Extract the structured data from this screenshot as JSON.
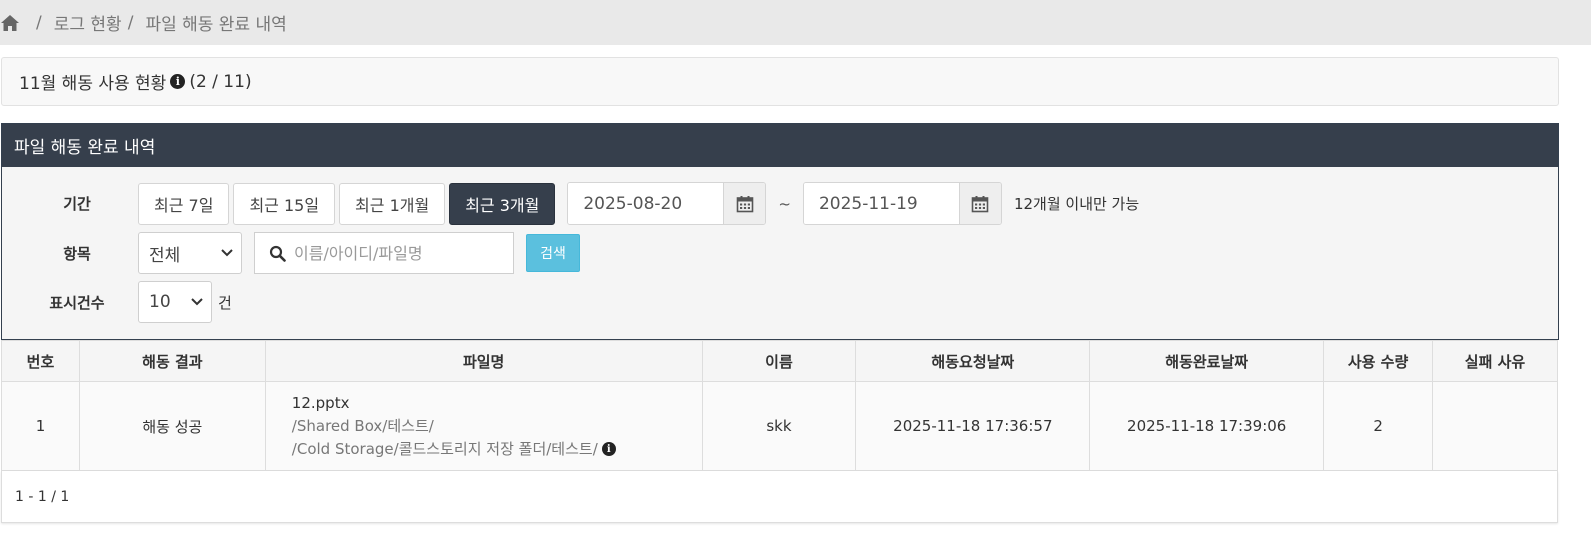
{
  "breadcrumb": {
    "home_icon": "home-icon",
    "separator": "/",
    "items": [
      "로그 현황",
      "파일 해동 완료 내역"
    ]
  },
  "usage": {
    "label": "11월 해동 사용 현황",
    "info_icon": "info-circle-icon",
    "count": "(2 / 11)"
  },
  "panel": {
    "title": "파일 해동 완료 내역",
    "period_label": "기간",
    "period_buttons": [
      "최근 7일",
      "최근 15일",
      "최근 1개월",
      "최근 3개월"
    ],
    "active_period": "최근 3개월",
    "start_date": "2025-08-20",
    "end_date": "2025-11-19",
    "calendar_icon": "calendar-icon",
    "tilde": "~",
    "date_note": "12개월 이내만 가능",
    "item_label": "항목",
    "item_select": "전체",
    "search_placeholder": "이름/아이디/파일명",
    "search_icon": "search-icon",
    "search_button": "검색",
    "count_label": "표시건수",
    "count_select": "10",
    "count_unit": "건"
  },
  "table": {
    "headers": [
      "번호",
      "해동 결과",
      "파일명",
      "이름",
      "해동요청날짜",
      "해동완료날짜",
      "사용 수량",
      "실패 사유"
    ],
    "rows": [
      {
        "no": "1",
        "result": "해동 성공",
        "file_name": "12.pptx",
        "path1": "/Shared Box/테스트/",
        "path2": "/Cold Storage/콜드스토리지 저장 폴더/테스트/",
        "name": "skk",
        "request_date": "2025-11-18 17:36:57",
        "complete_date": "2025-11-18 17:39:06",
        "usage": "2",
        "fail_reason": ""
      }
    ]
  },
  "pager": {
    "summary": "1 - 1 / 1"
  },
  "colors": {
    "header_bg": "#363f4c",
    "search_button": "#5bc0de",
    "active_button": "#363f4c"
  }
}
